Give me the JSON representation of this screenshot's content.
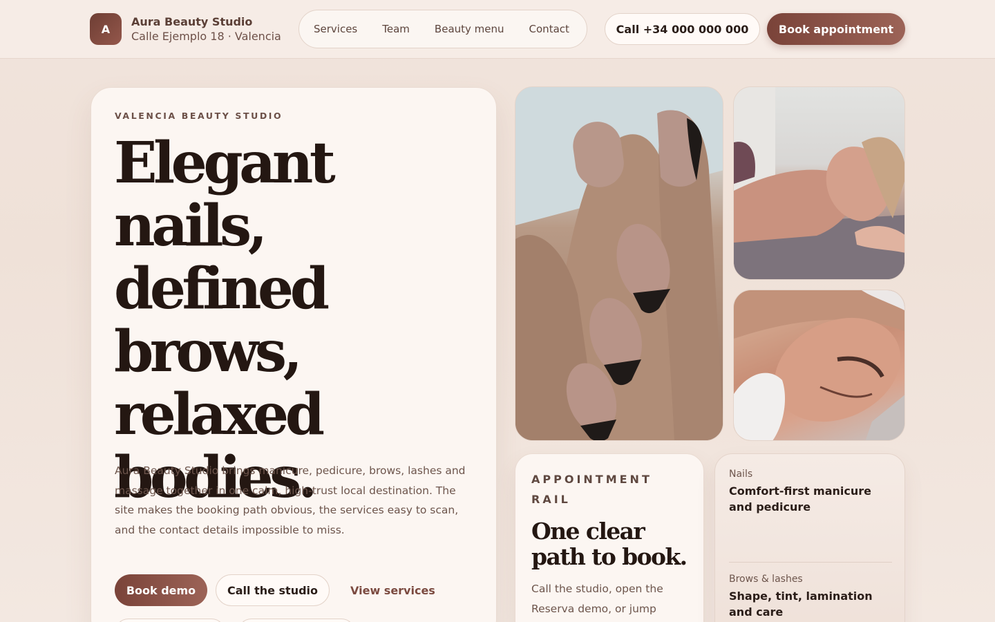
{
  "header": {
    "badge_letter": "A",
    "brand_name": "Aura Beauty Studio",
    "brand_address": "Calle Ejemplo 18 · Valencia",
    "nav": [
      "Services",
      "Team",
      "Beauty menu",
      "Contact"
    ],
    "call_label": "Call +34 000 000 000",
    "book_label": "Book appointment"
  },
  "hero": {
    "eyebrow": "VALENCIA BEAUTY STUDIO",
    "headline": "Elegant nails, defined brows, relaxed bodies.",
    "intro": "Aura Beauty Studio brings manicure, pedicure, brows, lashes and massage together in one calm, high-trust local destination. The site makes the booking path obvious, the services easy to scan, and the contact details impossible to miss.",
    "book_demo": "Book demo",
    "call_studio": "Call the studio",
    "view_services": "View services"
  },
  "rail": {
    "eyebrow": "APPOINTMENT RAIL",
    "title": "One clear path to book.",
    "text": "Call the studio, open the Reserva demo, or jump"
  },
  "services": [
    {
      "category": "Nails",
      "title": "Comfort-first manicure and pedicure"
    },
    {
      "category": "Brows & lashes",
      "title": "Shape, tint, lamination and care"
    }
  ],
  "colors": {
    "accent": "#7a4339",
    "text_dark": "#241712",
    "background": "#f1e4dc"
  }
}
